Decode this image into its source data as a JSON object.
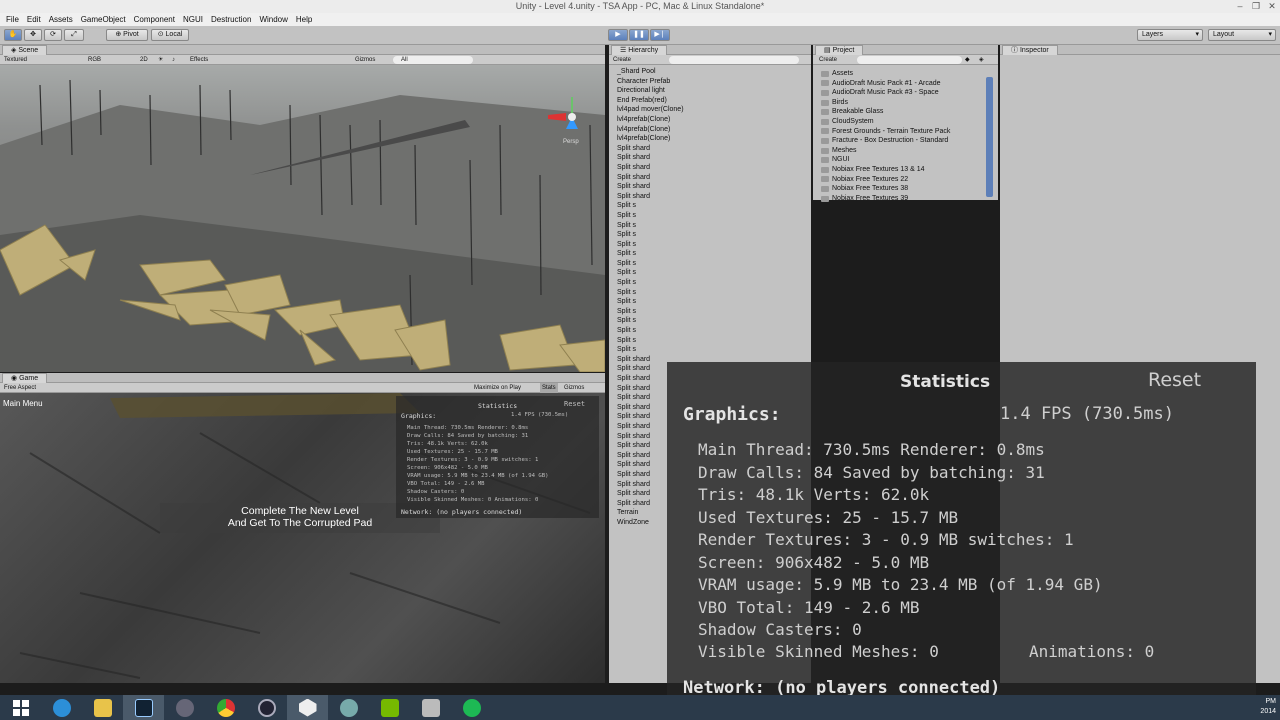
{
  "window": {
    "title": "Unity - Level 4.unity - TSA App - PC, Mac & Linux Standalone*"
  },
  "menu": [
    "File",
    "Edit",
    "Assets",
    "GameObject",
    "Component",
    "NGUI",
    "Destruction",
    "Window",
    "Help"
  ],
  "toolbar": {
    "pivot": "Pivot",
    "local": "Local",
    "layers": "Layers",
    "layout": "Layout"
  },
  "scene": {
    "tab": "Scene",
    "shading": "Textured",
    "rgb": "RGB",
    "mode2d": "2D",
    "effects": "Effects",
    "gizmos": "Gizmos",
    "search": "All",
    "persp": "Persp"
  },
  "game": {
    "tab": "Game",
    "aspect": "Free Aspect",
    "maximize": "Maximize on Play",
    "stats": "Stats",
    "gizmos": "Gizmos",
    "main_menu": "Main Menu",
    "message_line1": "Complete The New Level",
    "message_line2": "And Get To The Corrupted Pad"
  },
  "small_stats": {
    "title": "Statistics",
    "reset": "Reset",
    "graphics": "Graphics:",
    "fps": "1.4 FPS (730.5ms)",
    "lines": [
      "Main Thread: 730.5ms  Renderer: 0.8ms",
      "Draw Calls: 84    Saved by batching: 31",
      "Tris: 48.1k   Verts: 62.0k",
      "Used Textures: 25 - 15.7 MB",
      "Render Textures: 3 - 0.9 MB switches: 1",
      "Screen: 906x482 - 5.0 MB",
      "VRAM usage: 5.9 MB to 23.4 MB (of 1.94 GB)",
      "VBO Total: 149 - 2.6 MB",
      "Shadow Casters: 0",
      "Visible Skinned Meshes: 0    Animations: 0"
    ],
    "network": "Network: (no players connected)"
  },
  "hierarchy": {
    "tab": "Hierarchy",
    "create": "Create",
    "items": [
      "_Shard Pool",
      "Character Prefab",
      "Directional light",
      "End Prefab(red)",
      "lvl4pad mover(Clone)",
      "lvl4prefab(Clone)",
      "lvl4prefab(Clone)",
      "lvl4prefab(Clone)",
      "Split shard",
      "Split shard",
      "Split shard",
      "Split shard",
      "Split shard",
      "Split shard",
      "Split s",
      "Split s",
      "Split s",
      "Split s",
      "Split s",
      "Split s",
      "Split s",
      "Split s",
      "Split s",
      "Split s",
      "Split s",
      "Split s",
      "Split s",
      "Split s",
      "Split s",
      "Split s",
      "Split shard",
      "Split shard",
      "Split shard",
      "Split shard",
      "Split shard",
      "Split shard",
      "Split shard",
      "Split shard",
      "Split shard",
      "Split shard",
      "Split shard",
      "Split shard",
      "Split shard",
      "Split shard",
      "Split shard",
      "Split shard",
      "Terrain",
      "WindZone"
    ]
  },
  "project": {
    "tab": "Project",
    "create": "Create",
    "items": [
      "Assets",
      "AudioDraft Music Pack #1 - Arcade",
      "AudioDraft Music Pack #3 - Space",
      "Birds",
      "Breakable Glass",
      "CloudSystem",
      "Forest Grounds - Terrain Texture Pack",
      "Fracture - Box Destruction - Standard",
      "Meshes",
      "NGUI",
      "Nobiax Free Textures 13 & 14",
      "Nobiax Free Textures 22",
      "Nobiax Free Textures 38",
      "Nobiax Free Textures 39"
    ]
  },
  "inspector": {
    "tab": "Inspector"
  },
  "stats": {
    "title": "Statistics",
    "reset": "Reset",
    "graphics": "Graphics:",
    "fps": "1.4 FPS (730.5ms)",
    "main_thread": "Main Thread: 730.5ms  Renderer: 0.8ms",
    "draw_calls": "Draw Calls: 84    Saved by batching: 31",
    "tris": "Tris: 48.1k  Verts: 62.0k",
    "used_textures": "Used Textures: 25 - 15.7 MB",
    "render_textures": "Render Textures: 3 - 0.9 MB switches: 1",
    "screen": "Screen: 906x482 - 5.0 MB",
    "vram": "VRAM usage: 5.9 MB to 23.4 MB (of 1.94 GB)",
    "vbo": "VBO Total: 149 - 2.6 MB",
    "shadow": "Shadow Casters: 0",
    "skinned": "Visible Skinned Meshes: 0",
    "animations": "Animations: 0",
    "network": "Network: (no players connected)"
  },
  "clock": {
    "time": "PM",
    "year": "2014"
  },
  "colors": {
    "accent": "#5c80bc",
    "panel": "#c2c2c2",
    "overlay": "#232323"
  }
}
